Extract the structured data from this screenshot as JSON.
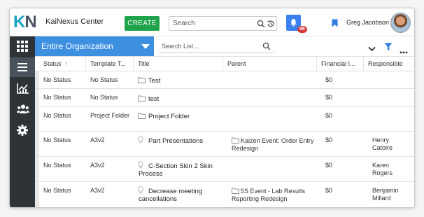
{
  "app": {
    "logo_k": "K",
    "logo_n": "N",
    "title": "KaiNexus Center",
    "create_label": "CREATE",
    "search_placeholder": "Search",
    "notification_count": "98",
    "user_name": "Greg Jacobson"
  },
  "toolbar": {
    "org_label": "Entire Organization",
    "list_search_placeholder": "Search List..."
  },
  "sidebar": {
    "items": [
      {
        "icon": "grid-icon"
      },
      {
        "icon": "list-icon",
        "active": true
      },
      {
        "icon": "chart-icon"
      },
      {
        "icon": "people-icon"
      },
      {
        "icon": "gear-icon"
      }
    ]
  },
  "table": {
    "headers": [
      "Status",
      "Template T...",
      "Title",
      "Parent",
      "Financial I...",
      "Responsible"
    ],
    "rows": [
      {
        "status": "No Status",
        "template": "No Status",
        "icon": "folder",
        "title": "Test",
        "parent": "",
        "parent_icon": false,
        "financial": "$0",
        "responsible": ""
      },
      {
        "status": "No Status",
        "template": "No Status",
        "icon": "folder",
        "title": "test",
        "parent": "",
        "parent_icon": false,
        "financial": "$0",
        "responsible": ""
      },
      {
        "status": "No Status",
        "template": "Project Folder",
        "icon": "folder",
        "title": "Project Folder",
        "parent": "",
        "parent_icon": false,
        "financial": "$0",
        "responsible": ""
      },
      {
        "status": "No Status",
        "template": "A3v2",
        "icon": "bulb",
        "title": "Part Presentations",
        "parent": "Kaizen Event: Order Entry Redesign",
        "parent_icon": true,
        "financial": "$0",
        "responsible": "Henry Catoire"
      },
      {
        "status": "No Status",
        "template": "A3v2",
        "icon": "bulb",
        "title": "C-Section Skin 2 Skin Process",
        "parent": "",
        "parent_icon": false,
        "financial": "$0",
        "responsible": "Karen Rogers"
      },
      {
        "status": "No Status",
        "template": "A3v2",
        "icon": "bulb",
        "title": "Decrease meeting cancellations",
        "parent": "5S Event - Lab Results Reporting Redesign",
        "parent_icon": true,
        "financial": "$0",
        "responsible": "Benjamin Millard"
      }
    ]
  }
}
